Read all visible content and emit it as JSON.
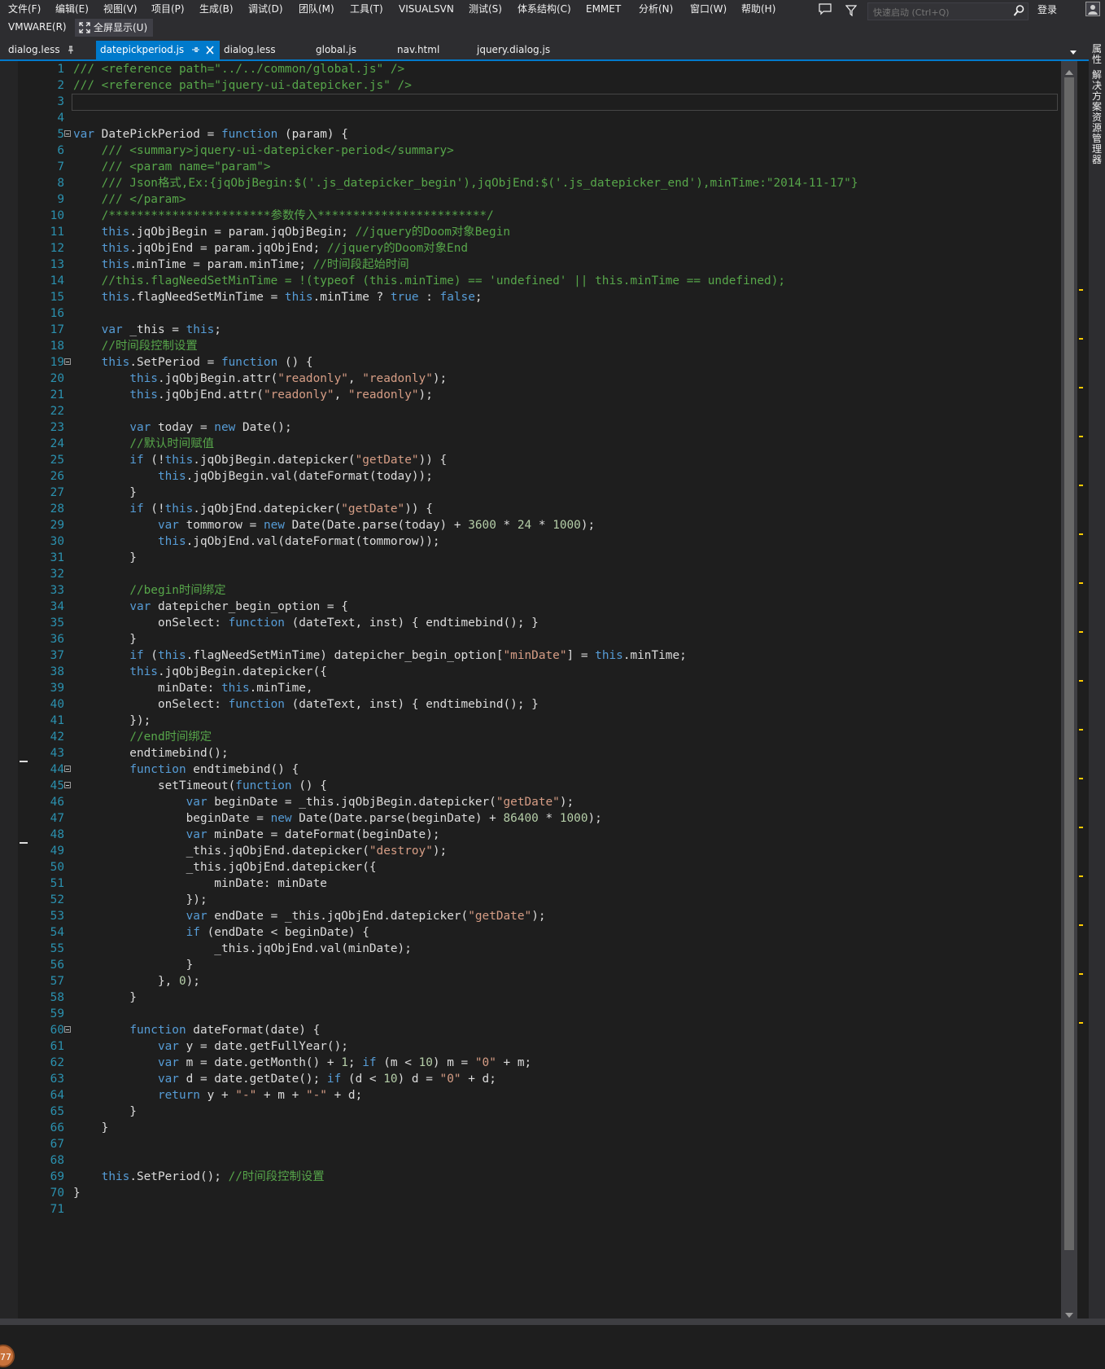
{
  "menu": {
    "items": [
      "文件(F)",
      "编辑(E)",
      "视图(V)",
      "项目(P)",
      "生成(B)",
      "调试(D)",
      "团队(M)",
      "工具(T)",
      "VISUALSVN",
      "测试(S)",
      "体系结构(C)",
      "EMMET",
      "分析(N)",
      "窗口(W)",
      "帮助(H)"
    ],
    "row2_item": "VMWARE(R)",
    "fullscreen_label": "全屏显示(U)"
  },
  "quick_launch": {
    "placeholder": "快速启动 (Ctrl+Q)"
  },
  "signin_label": "登录",
  "tabs": [
    {
      "label": "dialog.less"
    },
    {
      "label": "datepickperiod.js"
    },
    {
      "label": "dialog.less"
    },
    {
      "label": "global.js"
    },
    {
      "label": "nav.html"
    },
    {
      "label": "jquery.dialog.js"
    }
  ],
  "right_dock_labels": [
    "属性",
    "解决方案资源管理器"
  ],
  "zoom_badge": "77",
  "code": [
    "/// <reference path=\"../../common/global.js\" />",
    "/// <reference path=\"jquery-ui-datepicker.js\" />",
    "",
    "",
    "var DatePickPeriod = function (param) {",
    "    /// <summary>jquery-ui-datepicker-period</summary>",
    "    /// <param name=\"param\">",
    "    /// Json格式,Ex:{jqObjBegin:$('.js_datepicker_begin'),jqObjEnd:$('.js_datepicker_end'),minTime:\"2014-11-17\"}",
    "    /// </param>",
    "    /***********************参数传入************************/",
    "    this.jqObjBegin = param.jqObjBegin; //jquery的Doom对象Begin",
    "    this.jqObjEnd = param.jqObjEnd; //jquery的Doom对象End",
    "    this.minTime = param.minTime; //时间段起始时间",
    "    //this.flagNeedSetMinTime = !(typeof (this.minTime) == 'undefined' || this.minTime == undefined);",
    "    this.flagNeedSetMinTime = this.minTime ? true : false;",
    "",
    "    var _this = this;",
    "    //时间段控制设置",
    "    this.SetPeriod = function () {",
    "        this.jqObjBegin.attr(\"readonly\", \"readonly\");",
    "        this.jqObjEnd.attr(\"readonly\", \"readonly\");",
    "",
    "        var today = new Date();",
    "        //默认时间赋值",
    "        if (!this.jqObjBegin.datepicker(\"getDate\")) {",
    "            this.jqObjBegin.val(dateFormat(today));",
    "        }",
    "        if (!this.jqObjEnd.datepicker(\"getDate\")) {",
    "            var tommorow = new Date(Date.parse(today) + 3600 * 24 * 1000);",
    "            this.jqObjEnd.val(dateFormat(tommorow));",
    "        }",
    "",
    "        //begin时间绑定",
    "        var datepicher_begin_option = {",
    "            onSelect: function (dateText, inst) { endtimebind(); }",
    "        }",
    "        if (this.flagNeedSetMinTime) datepicher_begin_option[\"minDate\"] = this.minTime;",
    "        this.jqObjBegin.datepicker({",
    "            minDate: this.minTime,",
    "            onSelect: function (dateText, inst) { endtimebind(); }",
    "        });",
    "        //end时间绑定",
    "        endtimebind();",
    "        function endtimebind() {",
    "            setTimeout(function () {",
    "                var beginDate = _this.jqObjBegin.datepicker(\"getDate\");",
    "                beginDate = new Date(Date.parse(beginDate) + 86400 * 1000);",
    "                var minDate = dateFormat(beginDate);",
    "                _this.jqObjEnd.datepicker(\"destroy\");",
    "                _this.jqObjEnd.datepicker({",
    "                    minDate: minDate",
    "                });",
    "                var endDate = _this.jqObjEnd.datepicker(\"getDate\");",
    "                if (endDate < beginDate) {",
    "                    _this.jqObjEnd.val(minDate);",
    "                }",
    "            }, 0);",
    "        }",
    "",
    "        function dateFormat(date) {",
    "            var y = date.getFullYear();",
    "            var m = date.getMonth() + 1; if (m < 10) m = \"0\" + m;",
    "            var d = date.getDate(); if (d < 10) d = \"0\" + d;",
    "            return y + \"-\" + m + \"-\" + d;",
    "        }",
    "    }",
    "",
    "",
    "    this.SetPeriod(); //时间段控制设置",
    "}",
    ""
  ]
}
